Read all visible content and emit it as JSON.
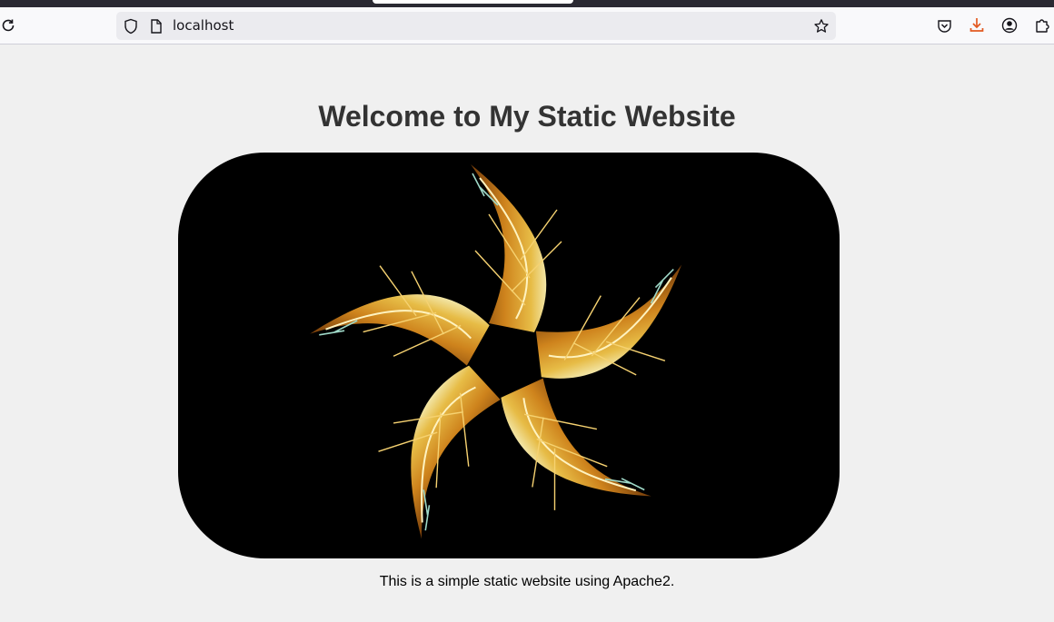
{
  "browser": {
    "address": "localhost",
    "icons": {
      "reload": "reload-icon",
      "tracking_protection": "shield-icon",
      "page_info": "page-icon",
      "bookmark": "star-icon",
      "pocket": "pocket-icon",
      "downloads": "download-icon",
      "account": "account-icon",
      "extensions": "puzzle-icon"
    },
    "colors": {
      "download_accent": "#e25920",
      "toolbar_icon": "#15141a"
    }
  },
  "page": {
    "title": "Welcome to My Static Website",
    "caption": "This is a simple static website using Apache2.",
    "image": "fractal-star-image"
  }
}
